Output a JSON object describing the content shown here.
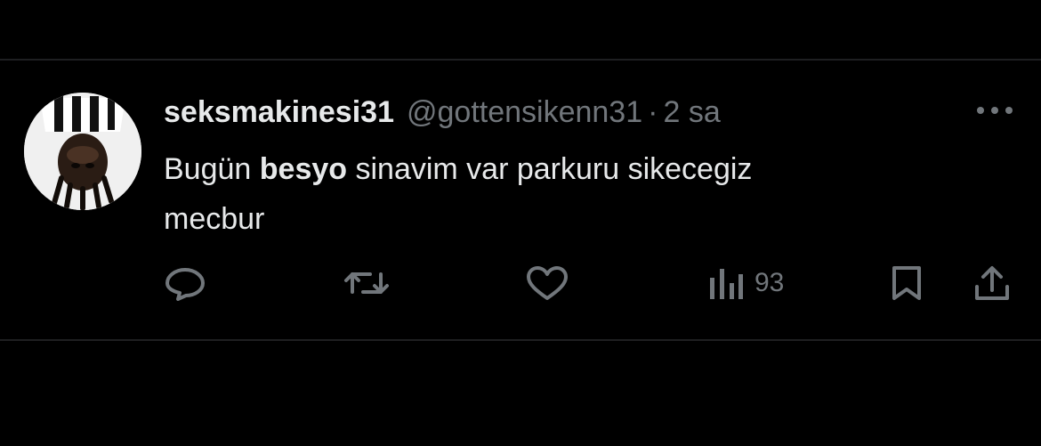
{
  "tweet": {
    "display_name": "seksmakinesi31",
    "handle": "@gottensikenn31",
    "separator": "·",
    "time": "2 sa",
    "text_before": "Bugün ",
    "text_bold": "besyo",
    "text_after_line1": " sinavim var parkuru sikecegiz",
    "text_line2": "mecbur"
  },
  "actions": {
    "views_count": "93"
  },
  "icons": {
    "more": "more-horizontal-icon",
    "reply": "reply-icon",
    "retweet": "retweet-icon",
    "like": "heart-icon",
    "views": "views-icon",
    "bookmark": "bookmark-icon",
    "share": "share-icon"
  },
  "colors": {
    "background": "#000000",
    "primary_text": "#e7e9ea",
    "secondary_text": "#71767b",
    "divider": "#1e1f21"
  }
}
